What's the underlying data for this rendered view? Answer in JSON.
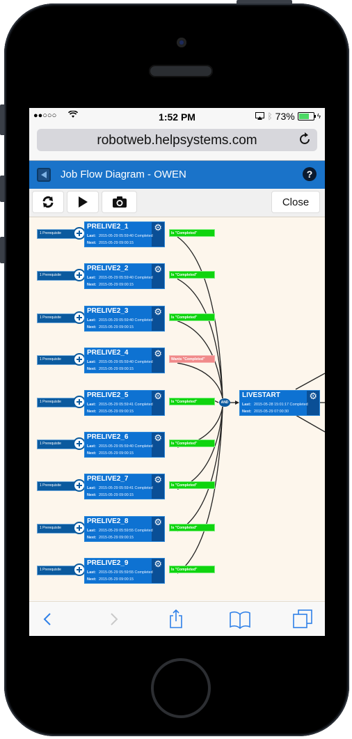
{
  "status_bar": {
    "signal": "●●○○○",
    "wifi_icon": "wifi-icon",
    "time": "1:52 PM",
    "airplay_icon": "airplay-icon",
    "bluetooth_icon": "bluetooth-icon",
    "battery_percent": "73%",
    "battery_level": 0.73,
    "charging_icon": "charging-bolt-icon"
  },
  "browser": {
    "url": "robotweb.helpsystems.com",
    "reload_icon": "reload-icon"
  },
  "app": {
    "title": "Job Flow Diagram - OWEN",
    "back_icon": "back-square-icon",
    "help_icon": "help-icon",
    "help_glyph": "?"
  },
  "toolbar": {
    "refresh_glyph": "⟳",
    "play_glyph": "▶",
    "camera_glyph": "📷",
    "close_label": "Close"
  },
  "diagram": {
    "prerequisite_label": "1 Prerequisite",
    "gear_glyph": "⚙",
    "last_label": "Last:",
    "next_label": "Next:",
    "and_label": "AND",
    "jobs": [
      {
        "name": "PRELIVE2_1",
        "last": "2015-05-29 05:59:40 Completed",
        "next": "2015-05-29 09:00:15",
        "condition": "Is \"Completed\"",
        "condition_state": "ok"
      },
      {
        "name": "PRELIVE2_2",
        "last": "2015-05-29 05:59:40 Completed",
        "next": "2015-05-29 09:00:15",
        "condition": "Is \"Completed\"",
        "condition_state": "ok"
      },
      {
        "name": "PRELIVE2_3",
        "last": "2015-05-29 05:59:40 Completed",
        "next": "2015-05-29 09:00:15",
        "condition": "Is \"Completed\"",
        "condition_state": "ok"
      },
      {
        "name": "PRELIVE2_4",
        "last": "2015-05-29 05:59:40 Completed",
        "next": "2015-05-29 09:00:15",
        "condition": "Wants \"Completed\"",
        "condition_state": "want"
      },
      {
        "name": "PRELIVE2_5",
        "last": "2015-05-29 05:59:41 Completed",
        "next": "2015-05-29 09:00:15",
        "condition": "Is \"Completed\"",
        "condition_state": "ok"
      },
      {
        "name": "PRELIVE2_6",
        "last": "2015-05-29 05:59:40 Completed",
        "next": "2015-05-29 09:00:15",
        "condition": "Is \"Completed\"",
        "condition_state": "ok"
      },
      {
        "name": "PRELIVE2_7",
        "last": "2015-05-29 05:59:41 Completed",
        "next": "2015-05-29 09:00:15",
        "condition": "Is \"Completed\"",
        "condition_state": "ok"
      },
      {
        "name": "PRELIVE2_8",
        "last": "2015-05-29 05:59:55 Completed",
        "next": "2015-05-29 09:00:15",
        "condition": "Is \"Completed\"",
        "condition_state": "ok"
      },
      {
        "name": "PRELIVE2_9",
        "last": "2015-05-29 05:59:55 Completed",
        "next": "2015-05-29 09:00:15",
        "condition": "Is \"Completed\"",
        "condition_state": "ok"
      }
    ],
    "target_job": {
      "name": "LIVESTART",
      "last": "2015-05-28 15:01:17 Completed",
      "next": "2015-05-29 07:00:30"
    },
    "colors": {
      "job_blue": "#0e72d2",
      "job_dark": "#0a4f96",
      "condition_ok": "#0fd40f",
      "condition_want": "#f08a8a",
      "canvas_bg": "#fdf6ec"
    }
  },
  "browser_bottom": {
    "back_icon": "back-chevron-icon",
    "forward_icon": "forward-chevron-icon",
    "share_icon": "share-icon",
    "bookmarks_icon": "bookmarks-icon",
    "tabs_icon": "tabs-icon"
  }
}
